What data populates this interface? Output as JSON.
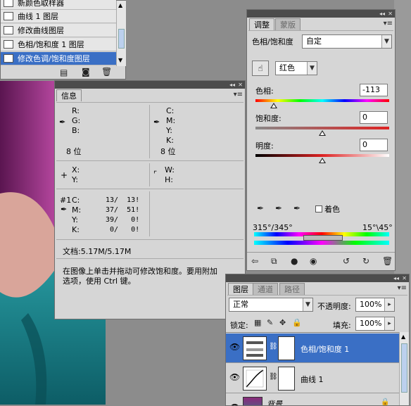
{
  "history": {
    "items": [
      {
        "label": "新颜色取样器",
        "selected": false
      },
      {
        "label": "曲线 1 图层",
        "selected": false
      },
      {
        "label": "修改曲线图层",
        "selected": false
      },
      {
        "label": "色相/饱和度 1 图层",
        "selected": false
      },
      {
        "label": "修改色调/饱和度图层",
        "selected": true
      }
    ]
  },
  "info": {
    "tab": "信息",
    "rgb": {
      "r": "R:",
      "g": "G:",
      "b": "B:",
      "bits": "8 位"
    },
    "cmyk": {
      "c": "C:",
      "m": "M:",
      "y": "Y:",
      "k": "K:",
      "bits": "8 位"
    },
    "xy": {
      "x": "X:",
      "y": "Y:"
    },
    "wh": {
      "w": "W:",
      "h": "H:"
    },
    "sampler": {
      "label": "#1",
      "rows": [
        {
          "ch": "C:",
          "v": "13/  13!"
        },
        {
          "ch": "M:",
          "v": "37/  51!"
        },
        {
          "ch": "Y:",
          "v": "39/   0!"
        },
        {
          "ch": "K:",
          "v": "0/   0!"
        }
      ]
    },
    "doc": "文档:5.17M/5.17M",
    "hint1": "在图像上单击并拖动可修改饱和度。要用附加",
    "hint2": "选项，使用 Ctrl 键。"
  },
  "adjust": {
    "tabs": [
      "调整",
      "蒙版"
    ],
    "title": "色相/饱和度",
    "preset": "自定",
    "channel": "红色",
    "hue_label": "色相:",
    "hue_value": "-113",
    "sat_label": "饱和度:",
    "sat_value": "0",
    "light_label": "明度:",
    "light_value": "0",
    "colorize_label": "着色",
    "range_left": "315°/345°",
    "range_right": "15°\\45°"
  },
  "layers": {
    "tabs": [
      "图层",
      "通道",
      "路径"
    ],
    "blend_mode": "正常",
    "opacity_label": "不透明度:",
    "opacity_value": "100%",
    "lock_label": "锁定:",
    "fill_label": "填充:",
    "fill_value": "100%",
    "items": [
      {
        "name": "色相/饱和度 1",
        "selected": true
      },
      {
        "name": "曲线 1",
        "selected": false
      },
      {
        "name": "背景",
        "selected": false
      }
    ]
  },
  "colors": {
    "selection": "#3a6fc5",
    "teal": "#1e8a92",
    "magenta": "#8a2a7a"
  }
}
